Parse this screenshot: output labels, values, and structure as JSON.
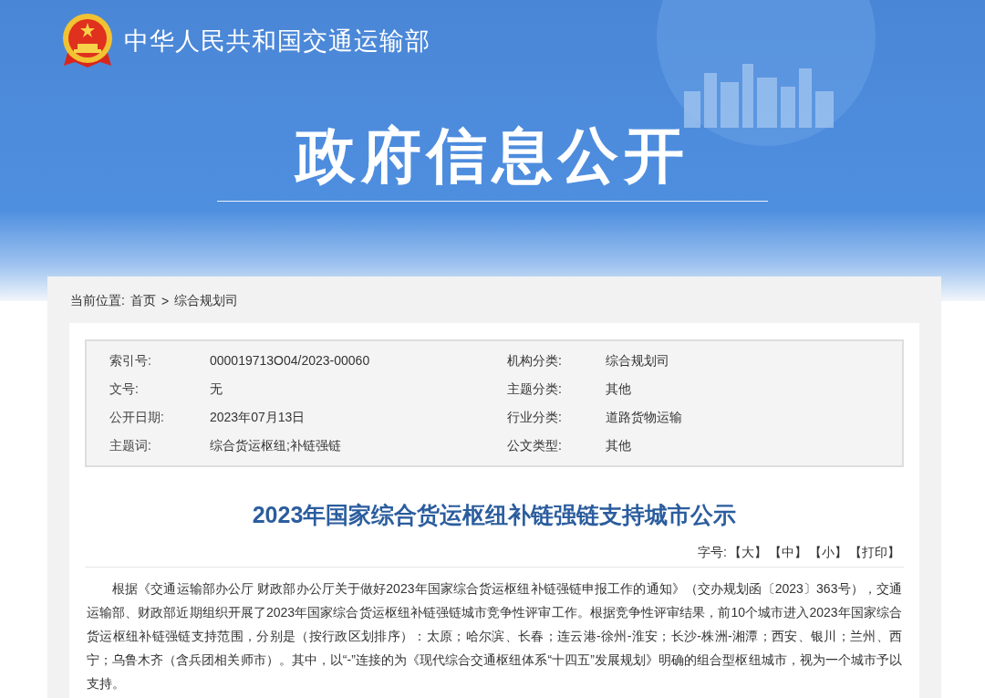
{
  "header": {
    "site_name": "中华人民共和国交通运输部",
    "banner_title": "政府信息公开"
  },
  "breadcrumb": {
    "label": "当前位置:",
    "items": [
      "首页",
      "综合规划司"
    ],
    "separator": ">"
  },
  "info_table": {
    "rows": [
      {
        "label": "索引号:",
        "value": "000019713O04/2023-00060",
        "label_2": "机构分类:",
        "value_2": "综合规划司"
      },
      {
        "label": "文号:",
        "value": "无",
        "label_2": "主题分类:",
        "value_2": "其他"
      },
      {
        "label": "公开日期:",
        "value": "2023年07月13日",
        "label_2": "行业分类:",
        "value_2": "道路货物运输"
      },
      {
        "label": "主题词:",
        "value": "综合货运枢纽;补链强链",
        "label_2": "公文类型:",
        "value_2": "其他"
      }
    ]
  },
  "article": {
    "title": "2023年国家综合货运枢纽补链强链支持城市公示",
    "font_size": {
      "label": "字号:",
      "options": [
        "【大】",
        "【中】",
        "【小】",
        "【打印】"
      ]
    },
    "paragraphs": [
      "根据《交通运输部办公厅 财政部办公厅关于做好2023年国家综合货运枢纽补链强链申报工作的通知》（交办规划函〔2023〕363号），交通运输部、财政部近期组织开展了2023年国家综合货运枢纽补链强链城市竞争性评审工作。根据竞争性评审结果，前10个城市进入2023年国家综合货运枢纽补链强链支持范围，分别是（按行政区划排序）：太原；哈尔滨、长春；连云港-徐州-淮安；长沙-株洲-湘潭；西安、银川；兰州、西宁；乌鲁木齐（含兵团相关师市）。其中，以“-”连接的为《现代综合交通枢纽体系“十四五”发展规划》明确的组合型枢纽城市，视为一个城市予以支持。"
    ]
  }
}
